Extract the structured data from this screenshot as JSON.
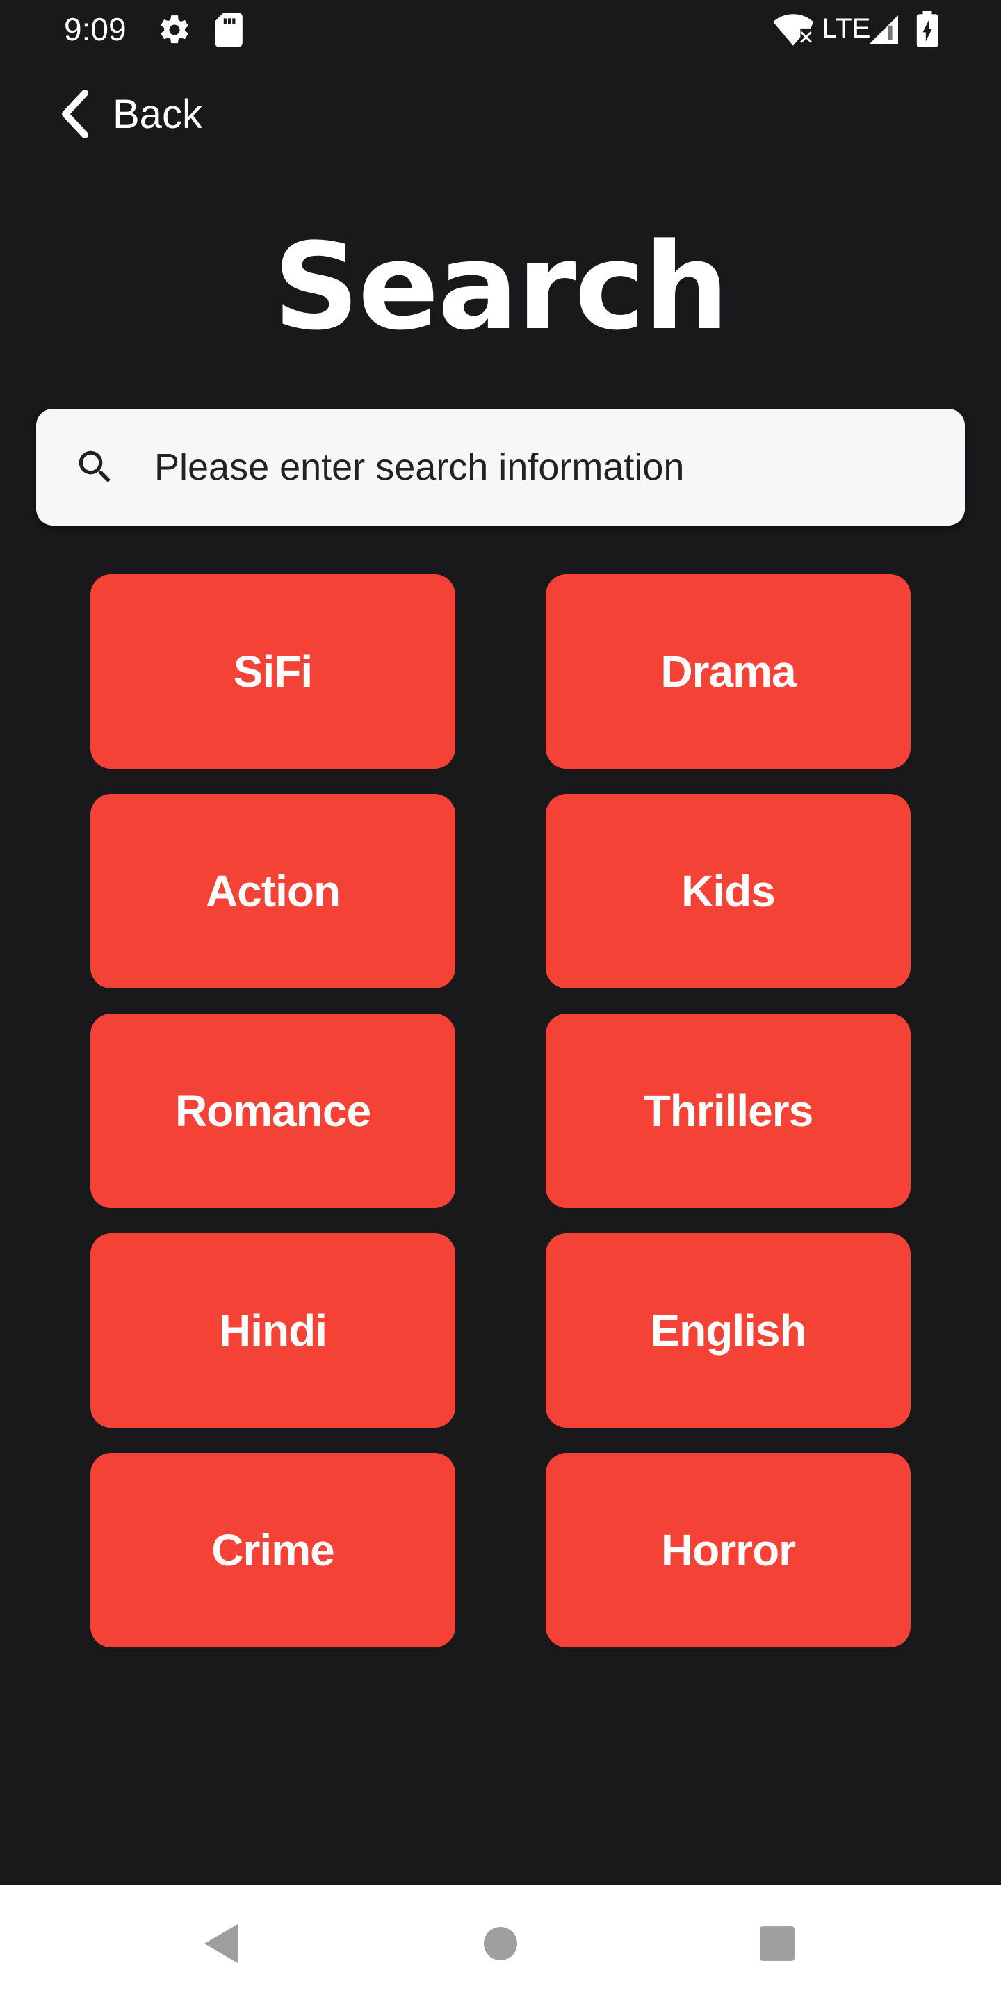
{
  "status_bar": {
    "time": "9:09",
    "network": "LTE",
    "icons": [
      "gear-icon",
      "sd-card-icon",
      "wifi-off-icon",
      "cell-signal-icon",
      "battery-charging-icon"
    ]
  },
  "header": {
    "back_label": "Back",
    "title": "Search"
  },
  "search": {
    "placeholder": "Please enter search information",
    "value": ""
  },
  "genres": [
    {
      "label": "SiFi"
    },
    {
      "label": "Drama"
    },
    {
      "label": "Action"
    },
    {
      "label": "Kids"
    },
    {
      "label": "Romance"
    },
    {
      "label": "Thrillers"
    },
    {
      "label": "Hindi"
    },
    {
      "label": "English"
    },
    {
      "label": "Crime"
    },
    {
      "label": "Horror"
    }
  ],
  "colors": {
    "background": "#19181a",
    "tile": "#f44336",
    "search_field": "#f7f7f7",
    "nav_bar": "#ffffff",
    "nav_icons": "#9e9e9e"
  },
  "nav_bar": {
    "icons": [
      "back-triangle-icon",
      "home-circle-icon",
      "recents-square-icon"
    ]
  }
}
